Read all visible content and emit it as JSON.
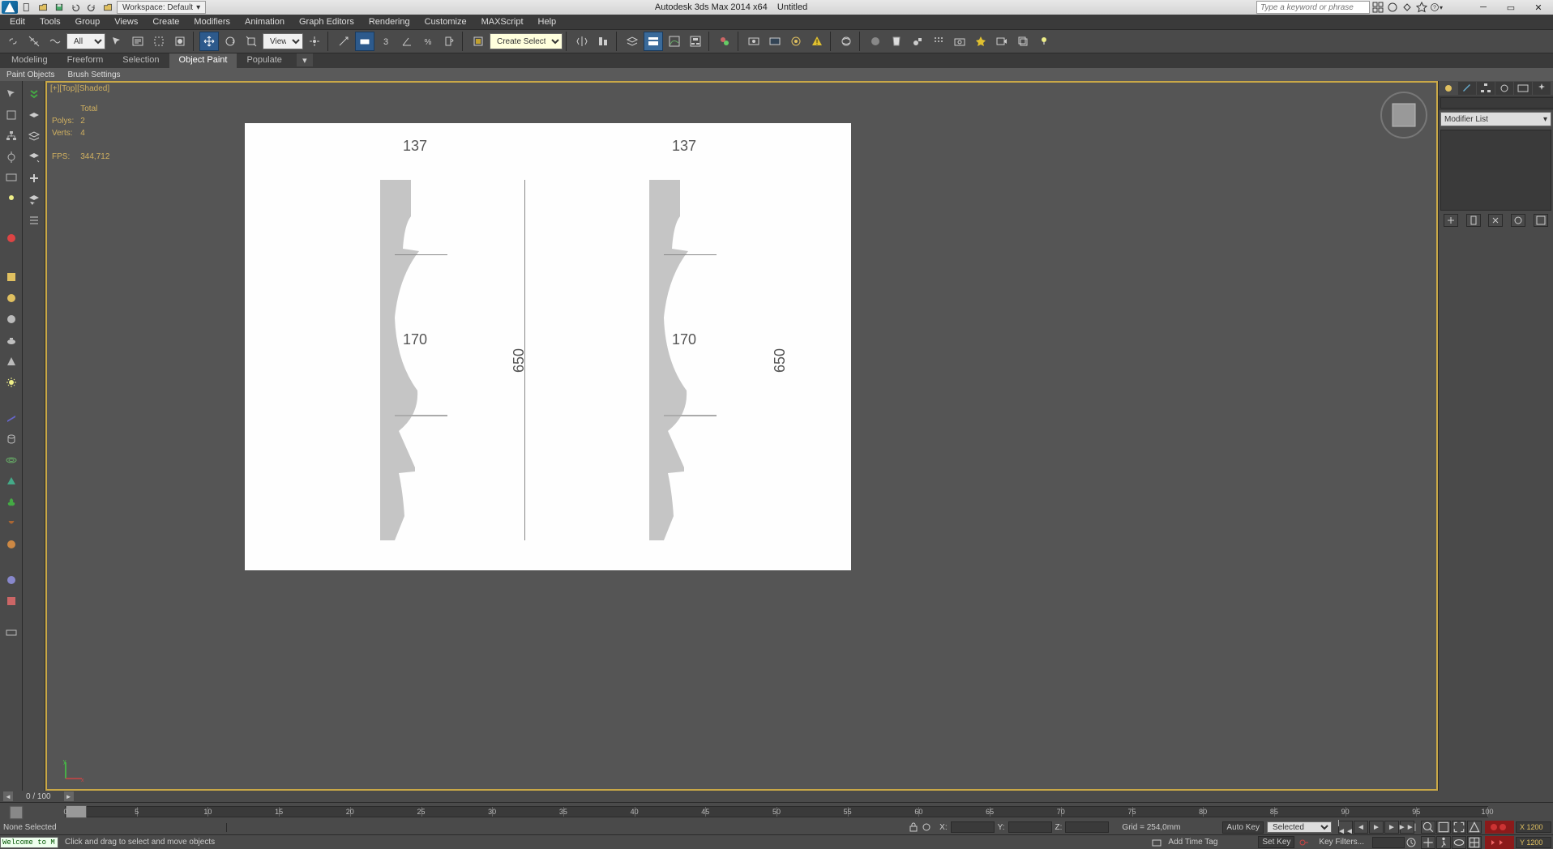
{
  "title": {
    "app": "Autodesk 3ds Max  2014 x64",
    "doc": "Untitled",
    "workspace": "Workspace: Default",
    "search_placeholder": "Type a keyword or phrase"
  },
  "menu": [
    "Edit",
    "Tools",
    "Group",
    "Views",
    "Create",
    "Modifiers",
    "Animation",
    "Graph Editors",
    "Rendering",
    "Customize",
    "MAXScript",
    "Help"
  ],
  "toolbar": {
    "filter_sel": "All",
    "view_sel": "View",
    "named_sel": "Create Selection Se"
  },
  "ribbon": {
    "tabs": [
      "Modeling",
      "Freeform",
      "Selection",
      "Object Paint",
      "Populate"
    ],
    "active": 3
  },
  "sub_toolbar": [
    "Paint Objects",
    "Brush Settings"
  ],
  "viewport": {
    "label": "[+][Top][Shaded]",
    "stats": {
      "total_label": "Total",
      "polys_label": "Polys:",
      "polys": "2",
      "verts_label": "Verts:",
      "verts": "4",
      "fps_label": "FPS:",
      "fps": "344,712"
    },
    "viewcube_face": "TOP",
    "dims": {
      "top1": "137",
      "top2": "137",
      "mid1": "170",
      "mid2": "170",
      "side1": "650",
      "side2": "650"
    }
  },
  "right_panel": {
    "modifier_list": "Modifier List"
  },
  "bottom": {
    "frame_range": "0 / 100",
    "tl_ticks": [
      0,
      5,
      10,
      15,
      20,
      25,
      30,
      35,
      40,
      45,
      50,
      55,
      60,
      65,
      70,
      75,
      80,
      85,
      90,
      95,
      100
    ],
    "selection": "None Selected",
    "coord_labels": {
      "x": "X:",
      "y": "Y:",
      "z": "Z:"
    },
    "grid": "Grid = 254,0mm",
    "auto_key": "Auto Key",
    "set_key": "Set Key",
    "selected": "Selected",
    "key_filters": "Key Filters...",
    "add_time_tag": "Add Time Tag",
    "script": "Welcome to M",
    "prompt": "Click and drag to select and move objects",
    "cursor_x": "X 1200",
    "cursor_y": "Y 1200"
  }
}
